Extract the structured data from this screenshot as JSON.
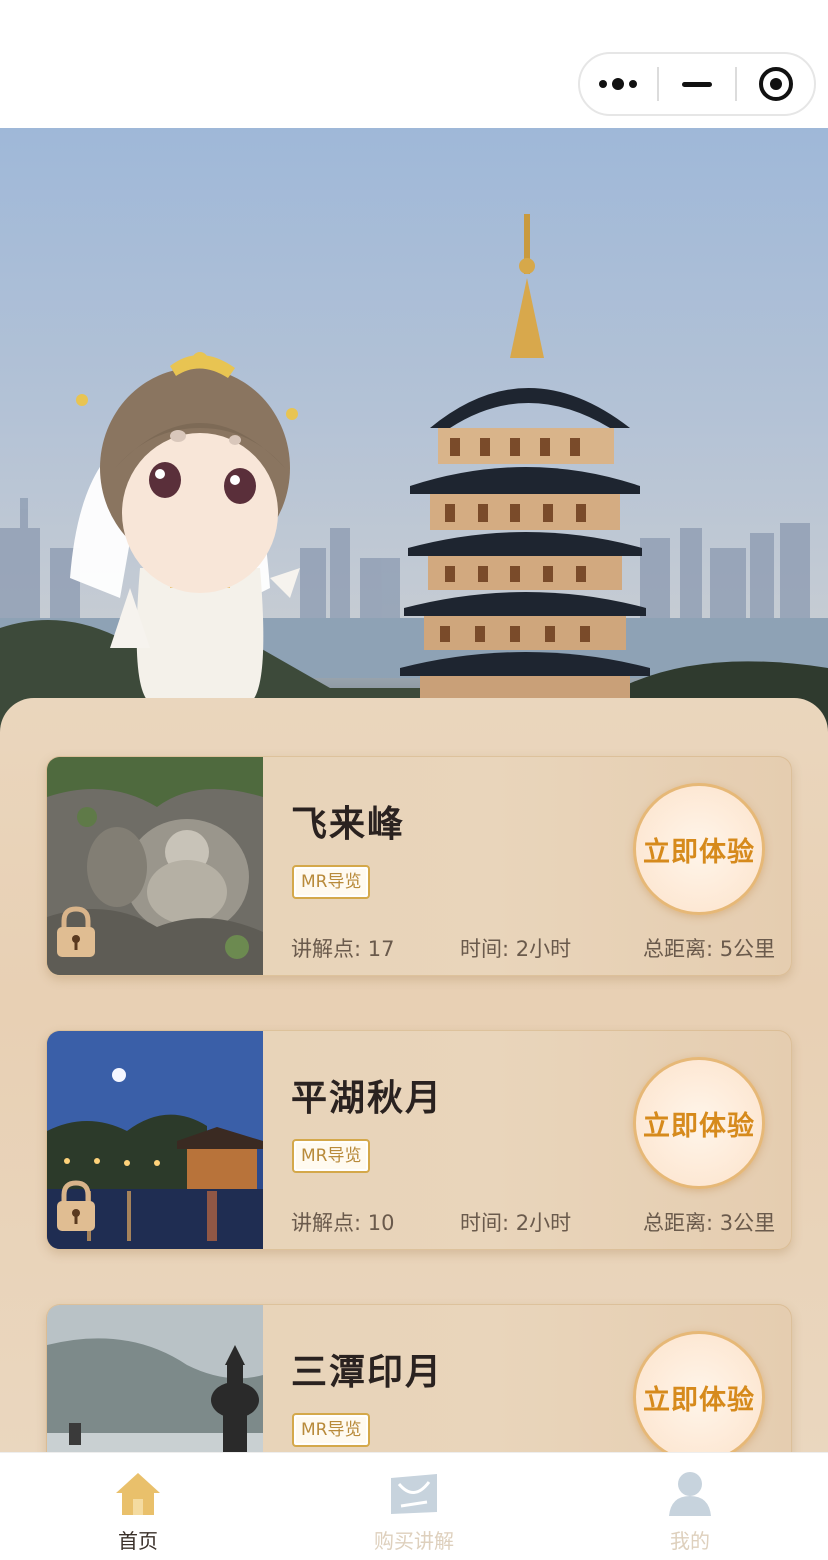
{
  "capsule": {
    "more": "more-icon",
    "minimize": "minus-icon",
    "close": "target-icon"
  },
  "tour_label": "MR导览",
  "cta_label": "立即体验",
  "spots": [
    {
      "title": "飞来峰",
      "points": "讲解点: 17",
      "time": "时间: 2小时",
      "distance": "总距离: 5公里",
      "locked": true
    },
    {
      "title": "平湖秋月",
      "points": "讲解点: 10",
      "time": "时间: 2小时",
      "distance": "总距离: 3公里",
      "locked": true
    },
    {
      "title": "三潭印月",
      "points": "",
      "time": "",
      "distance": "",
      "locked": false
    }
  ],
  "tabs": [
    {
      "label": "首页",
      "icon": "home-icon",
      "active": true
    },
    {
      "label": "购买讲解",
      "icon": "ticket-icon",
      "active": false
    },
    {
      "label": "我的",
      "icon": "user-icon",
      "active": false
    }
  ],
  "colors": {
    "accent": "#d68a1c",
    "badge_border": "#d4a84a",
    "tab_active_icon": "#e9c06b",
    "tab_inactive_icon": "#c7d3dd"
  }
}
